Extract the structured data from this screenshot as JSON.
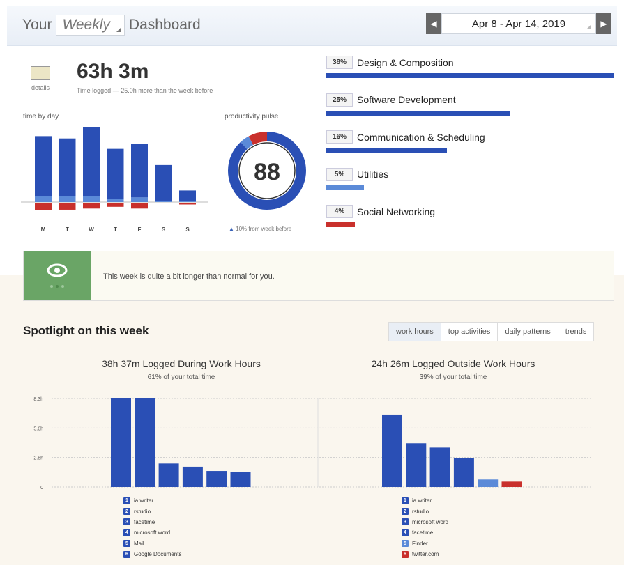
{
  "header": {
    "title_prefix": "Your",
    "period": "Weekly",
    "title_suffix": "Dashboard",
    "date_range": "Apr 8 - Apr 14, 2019",
    "prev_icon": "prev-arrow-icon",
    "next_icon": "next-arrow-icon"
  },
  "summary": {
    "details_label": "details",
    "total_time": "63h 3m",
    "time_note": "Time logged — 25.0h more than the week before"
  },
  "time_by_day": {
    "label": "time by day",
    "chart_data": {
      "type": "bar",
      "categories": [
        "M",
        "T",
        "W",
        "T",
        "F",
        "S",
        "S"
      ],
      "series": [
        {
          "values": [
            10.4,
            10.0,
            11.9,
            8.6,
            9.3,
            6.2,
            1.8
          ],
          "color": "#2a4fb5"
        },
        {
          "values": [
            1.0,
            1.0,
            1.0,
            0.6,
            0.8,
            0.2,
            0.2
          ],
          "color": "#5b8ad8"
        },
        {
          "values": [
            -1.3,
            -1.2,
            -1.0,
            -0.7,
            -1.0,
            0,
            -0.3
          ],
          "color": "#c9302c"
        }
      ],
      "colors": {
        "productive": "#2a4fb5",
        "neutral": "#5b8ad8",
        "distracting": "#c9302c"
      }
    }
  },
  "pulse": {
    "label": "productivity pulse",
    "score": "88",
    "note": "10% from week before",
    "chart_data": {
      "type": "pie",
      "values": [
        88,
        4,
        8
      ],
      "colors": [
        "#2a4fb5",
        "#5b8ad8",
        "#c9302c"
      ]
    }
  },
  "categories": [
    {
      "pct": "38%",
      "name": "Design & Composition",
      "share": 1.0,
      "color": "#2a4fb5"
    },
    {
      "pct": "25%",
      "name": "Software Development",
      "share": 0.64,
      "color": "#2a4fb5"
    },
    {
      "pct": "16%",
      "name": "Communication & Scheduling",
      "share": 0.42,
      "color": "#2a4fb5"
    },
    {
      "pct": "5%",
      "name": "Utilities",
      "share": 0.13,
      "color": "#5b8ad8"
    },
    {
      "pct": "4%",
      "name": "Social Networking",
      "share": 0.1,
      "color": "#c9302c"
    }
  ],
  "alert": {
    "icon": "eye-icon",
    "text": "This week is quite a bit longer than normal for you."
  },
  "spotlight": {
    "title": "Spotlight on this week",
    "tabs": [
      {
        "label": "work hours",
        "active": true
      },
      {
        "label": "top activities",
        "active": false
      },
      {
        "label": "daily patterns",
        "active": false
      },
      {
        "label": "trends",
        "active": false
      }
    ],
    "work": {
      "title": "38h 37m Logged During Work Hours",
      "note": "61% of your total time"
    },
    "outside": {
      "title": "24h 26m Logged Outside Work Hours",
      "note": "39% of your total time"
    },
    "chart_data": [
      {
        "type": "bar",
        "y_ticks": [
          "8.3h",
          "5.6h",
          "2.8h",
          "0"
        ],
        "ylim": [
          0,
          8.3
        ],
        "categories": [
          "ia writer",
          "rstudio",
          "facetime",
          "microsoft word",
          "Mail",
          "Google Documents"
        ],
        "values": [
          8.4,
          8.3,
          2.2,
          1.9,
          1.5,
          1.4
        ],
        "colors": [
          "#2a4fb5",
          "#2a4fb5",
          "#2a4fb5",
          "#2a4fb5",
          "#2a4fb5",
          "#2a4fb5"
        ]
      },
      {
        "type": "bar",
        "ylim": [
          0,
          8.3
        ],
        "categories": [
          "ia writer",
          "rstudio",
          "microsoft word",
          "facetime",
          "Finder",
          "twitter.com"
        ],
        "values": [
          6.8,
          4.1,
          3.7,
          2.7,
          0.7,
          0.5
        ],
        "colors": [
          "#2a4fb5",
          "#2a4fb5",
          "#2a4fb5",
          "#2a4fb5",
          "#5b8ad8",
          "#c9302c"
        ]
      }
    ]
  }
}
